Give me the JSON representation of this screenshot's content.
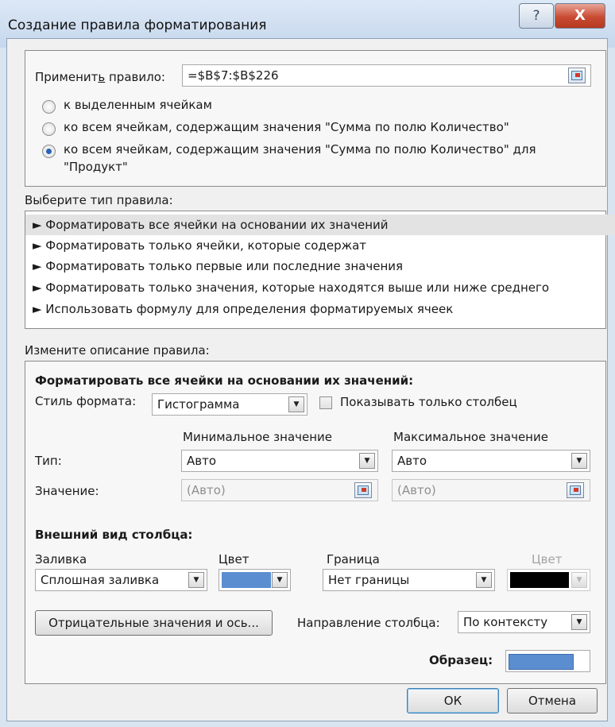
{
  "window": {
    "title": "Создание правила форматирования",
    "help_glyph": "?",
    "close_glyph": "X"
  },
  "apply": {
    "label": "Применит",
    "label_hotkey": "ь",
    "label_rest": " правило:",
    "value": "=$B$7:$B$226"
  },
  "scope_options": [
    {
      "label": "к выделенным ячейкам",
      "selected": false
    },
    {
      "label": "ко всем ячейкам, содержащим значения \"Сумма по полю Количество\"",
      "selected": false
    },
    {
      "label_line1": "ко всем ячейкам, содержащим значения \"Сумма по полю Количество\" для",
      "label_line2": "\"Продукт\"",
      "selected": true
    }
  ],
  "rule_type": {
    "heading": "Выберите тип правила:",
    "items": [
      "► Форматировать все ячейки на основании их значений",
      "► Форматировать только ячейки, которые содержат",
      "► Форматировать только первые или последние значения",
      "► Форматировать только значения, которые находятся выше или ниже среднего",
      "► Использовать формулу для определения форматируемых ячеек"
    ],
    "selected_index": 0
  },
  "edit": {
    "heading": "Измените описание правила:",
    "section_title": "Форматировать все ячейки на основании их значений:",
    "style_label": "Стиль формата:",
    "style_value": "Гистограмма",
    "show_bar_only_label": "Показывать только столбец",
    "show_bar_only_checked": false,
    "min_header": "Минимальное значение",
    "max_header": "Максимальное значение",
    "type_label": "Тип:",
    "type_min": "Авто",
    "type_max": "Авто",
    "value_label": "Значение:",
    "value_min": "(Авто)",
    "value_max": "(Авто)",
    "appearance_title": "Внешний вид столбца:",
    "fill_label": "Заливка",
    "fill_value": "Сплошная заливка",
    "color_label": "Цвет",
    "fill_color": "#5b8ed0",
    "border_label": "Граница",
    "border_value": "Нет границы",
    "border_color_label": "Цвет",
    "border_color": "#000000",
    "negative_button": "Отрицательные значения и ось...",
    "direction_label": "Направление столбца:",
    "direction_value": "По контексту",
    "preview_label": "Образец:",
    "preview_fill_fraction": 0.82
  },
  "buttons": {
    "ok": "ОК",
    "cancel": "Отмена"
  }
}
